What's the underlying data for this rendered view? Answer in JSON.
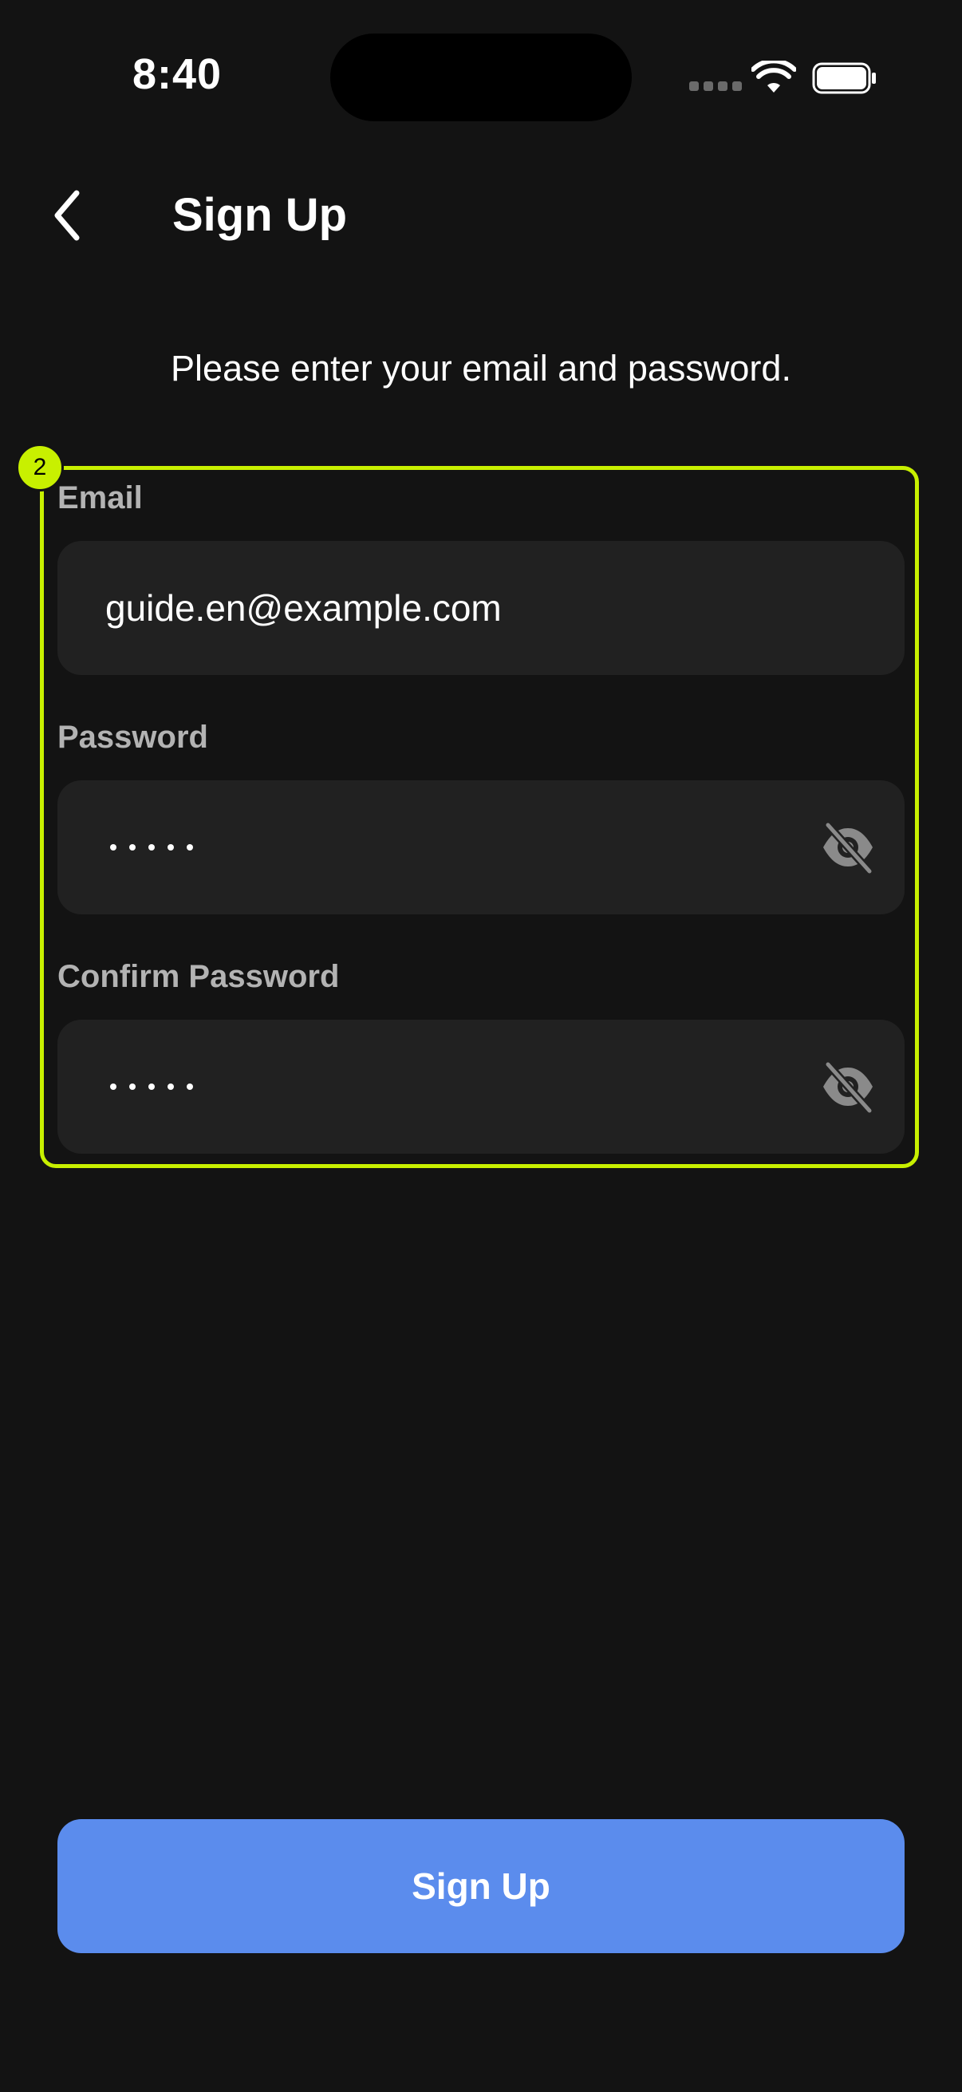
{
  "status_bar": {
    "time": "8:40"
  },
  "header": {
    "title": "Sign Up"
  },
  "instructions": "Please enter your email and password.",
  "highlight": {
    "badge": "2",
    "color": "#c8f000"
  },
  "form": {
    "email": {
      "label": "Email",
      "value": "guide.en@example.com"
    },
    "password": {
      "label": "Password",
      "masked_length": 5
    },
    "confirm_password": {
      "label": "Confirm Password",
      "masked_length": 5
    }
  },
  "submit": {
    "label": "Sign Up",
    "color": "#5b8ced"
  },
  "icons": {
    "back": "chevron-left-icon",
    "visibility_toggle": "eye-off-icon",
    "wifi": "wifi-icon",
    "battery": "battery-icon"
  }
}
